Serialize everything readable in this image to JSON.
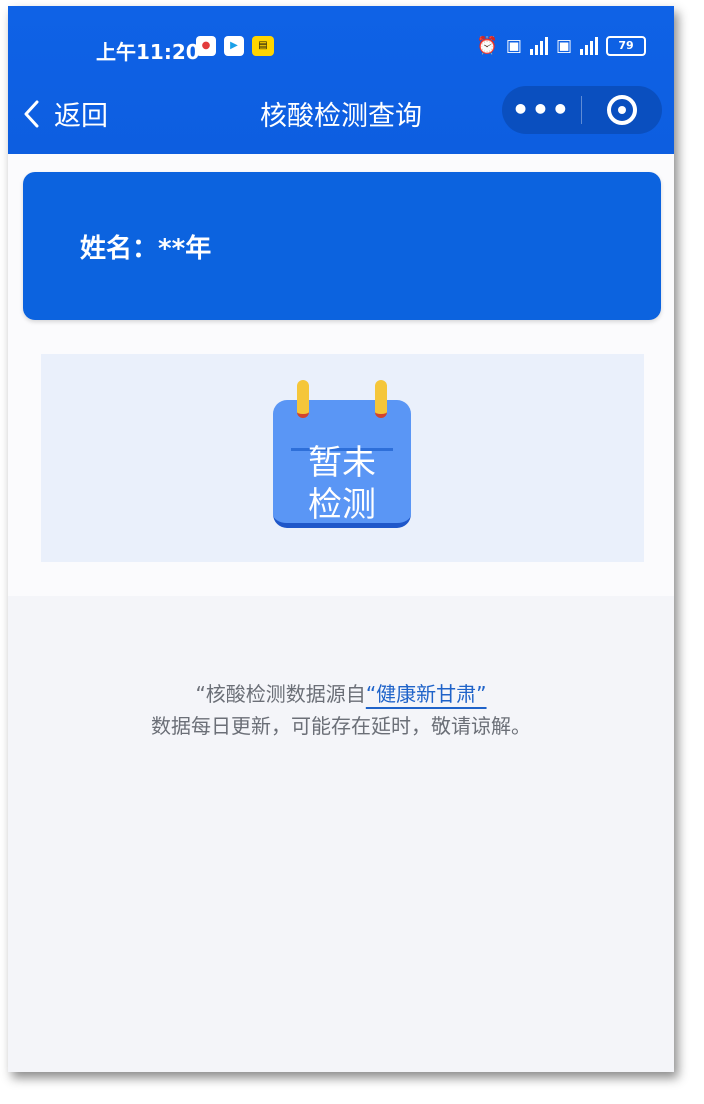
{
  "status_bar": {
    "time": "上午11:20",
    "battery": "79",
    "app_icons": [
      "map-pin-app-icon",
      "video-app-icon",
      "news-app-icon"
    ],
    "right_icons": [
      "alarm-icon",
      "sim1-icon",
      "wifi-signal-icon",
      "sim2-icon",
      "cell-signal-icon",
      "battery-icon"
    ]
  },
  "nav": {
    "back_label": "返回",
    "title": "核酸检测查询",
    "more_label": "•••"
  },
  "person": {
    "name_label": "姓名：**年"
  },
  "test_status": {
    "calendar_text_line1": "暂未",
    "calendar_text_line2": "检测"
  },
  "footer": {
    "source_prefix": "“核酸检测数据源自",
    "source_link": "“健康新甘肃”",
    "update_notice": "数据每日更新，可能存在延时，敬请谅解。"
  },
  "colors": {
    "primary": "#0f62e6",
    "card": "#0c63df",
    "calendar": "#5a96f5",
    "link": "#1f63c9"
  }
}
